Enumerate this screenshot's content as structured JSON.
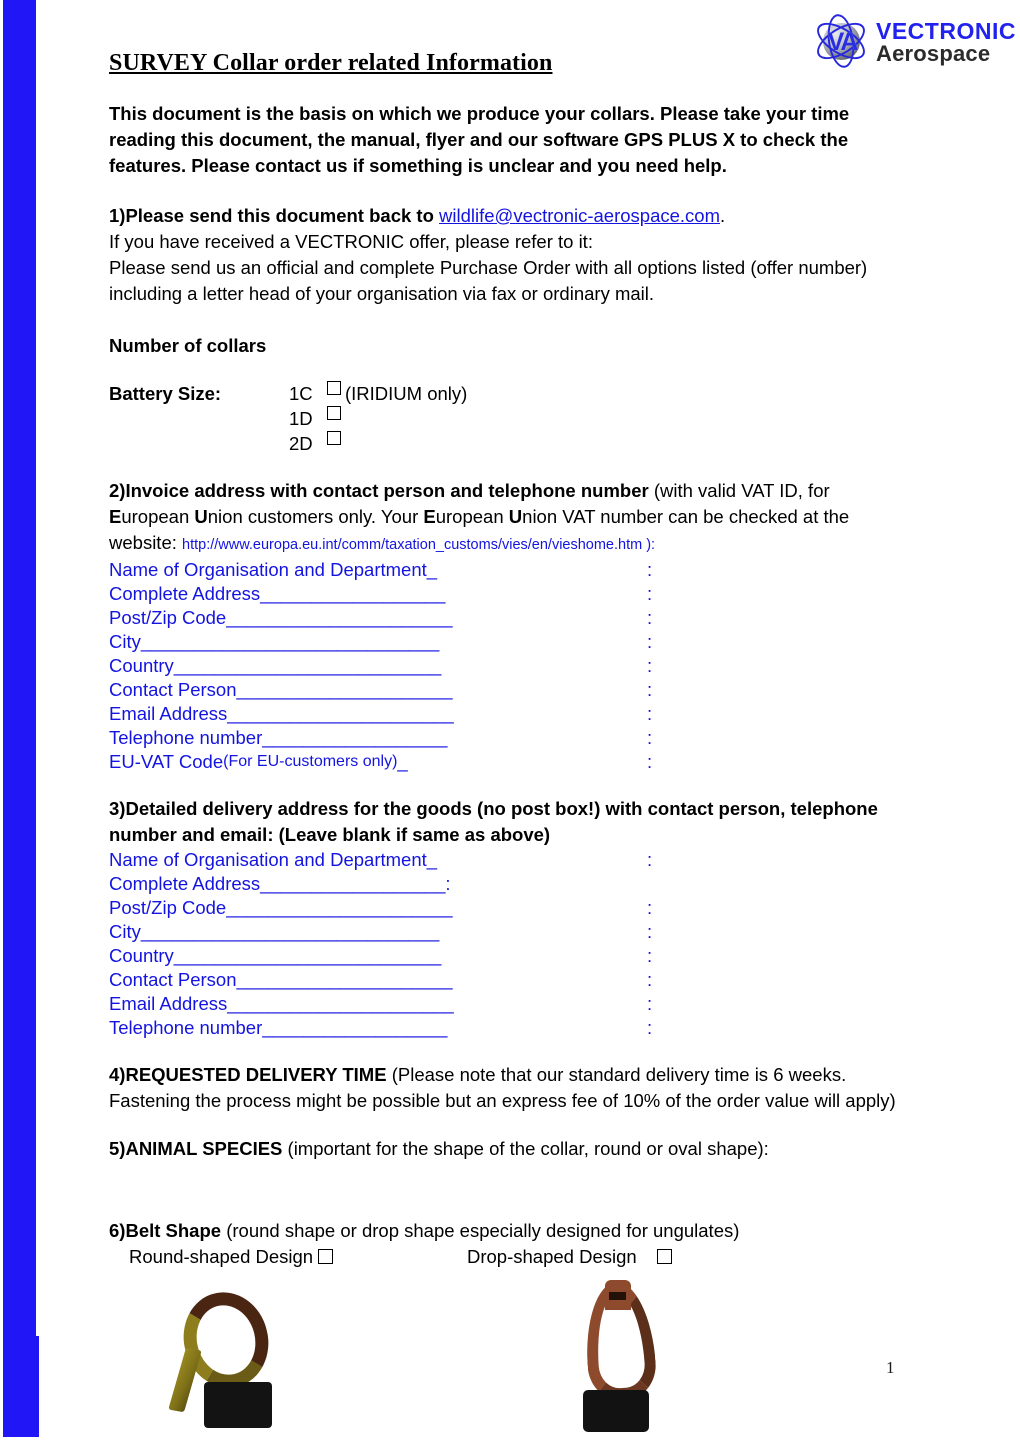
{
  "logo": {
    "monogram": "VA",
    "line1": "VECTRONIC",
    "line2": "Aerospace",
    "brand_blue": "#2222EE",
    "brand_dark": "#2b2b2b"
  },
  "document": {
    "title": "SURVEY Collar order related Information",
    "intro": "This document is the basis on which we produce your collars. Please take your time reading this document, the manual, flyer and our software GPS PLUS X to check the features. Please contact us if something is unclear and you need help.",
    "page_number": "1",
    "link_color": "#1414E0"
  },
  "section1": {
    "number": "1)",
    "lead": "Please send this document back to ",
    "email": "wildlife@vectronic-aerospace.com",
    "after_email": ".",
    "line2": "If you have received a VECTRONIC offer, please refer to it:",
    "line3": "Please send us an official and complete Purchase Order with all options listed (offer number) including a letter head of your organisation via fax or ordinary mail."
  },
  "collars": {
    "heading": "Number of collars",
    "battery_label": "Battery Size:",
    "options": [
      {
        "code": "1C",
        "note": "(IRIDIUM only)"
      },
      {
        "code": "1D",
        "note": ""
      },
      {
        "code": "2D",
        "note": ""
      }
    ]
  },
  "section2": {
    "number": "2)",
    "lead": "Invoice address with contact person and telephone number",
    "body_a": " (with valid VAT ID, for ",
    "eu_e1": "E",
    "eu_rest1": "uropean ",
    "eu_u1": "U",
    "eu_rest2": "nion customers only. Your ",
    "eu_e2": "E",
    "eu_rest3": "uropean ",
    "eu_u2": "U",
    "eu_rest4": "nion VAT number can be checked at the website: ",
    "url": "http://www.europa.eu.int/comm/taxation_customs/vies/en/vieshome.htm ):",
    "fields": [
      {
        "label": "Name of Organisation and Department",
        "rule": "_",
        "colon": ":"
      },
      {
        "label": "Complete Address",
        "rule": "__________________",
        "colon": ":"
      },
      {
        "label": "Post/Zip Code",
        "rule": "______________________",
        "colon": ":"
      },
      {
        "label": "City",
        "rule": "_____________________________",
        "colon": ":"
      },
      {
        "label": "Country",
        "rule": "__________________________",
        "colon": ":"
      },
      {
        "label": "Contact Person",
        "rule": "_____________________",
        "colon": ":"
      },
      {
        "label": "Email Address",
        "rule": "______________________",
        "colon": ":"
      },
      {
        "label": "Telephone number",
        "rule": "__________________",
        "colon": ":"
      },
      {
        "label": "EU-VAT Code ",
        "small": "(For EU-customers only)",
        "rule": "_",
        "colon": ":"
      }
    ]
  },
  "section3": {
    "number": "3)",
    "lead": "Detailed delivery address for the goods (no post box!) with contact person, telephone number and email: (Leave blank if same as above)",
    "fields": [
      {
        "label": "Name of Organisation and Department",
        "rule": "_",
        "colon": ":"
      },
      {
        "label": "Complete Address",
        "rule": "__________________",
        "colon": ":",
        "inline_colon": true
      },
      {
        "label": "Post/Zip Code",
        "rule": "______________________",
        "colon": ":"
      },
      {
        "label": "City",
        "rule": "_____________________________",
        "colon": ":"
      },
      {
        "label": "Country",
        "rule": "__________________________",
        "colon": ":"
      },
      {
        "label": "Contact Person",
        "rule": "_____________________",
        "colon": ":"
      },
      {
        "label": "Email Address",
        "rule": "______________________",
        "colon": ":"
      },
      {
        "label": "Telephone number",
        "rule": "__________________",
        "colon": ":"
      }
    ]
  },
  "section4": {
    "number": "4)",
    "lead": "REQUESTED DELIVERY TIME",
    "body": " (Please note that our standard delivery time is 6 weeks. Fastening the process might be possible but an express fee of 10% of the order value will apply)"
  },
  "section5": {
    "number": "5)",
    "lead": "ANIMAL SPECIES",
    "body": " (important for the shape of the collar, round or oval shape):"
  },
  "section6": {
    "number": "6)",
    "lead": "Belt Shape",
    "body": " (round shape or drop shape especially designed for ungulates)",
    "option_round": "Round-shaped Design",
    "option_drop": "Drop-shaped Design",
    "photo_round_alt": "round-shaped collar photo",
    "photo_drop_alt": "drop-shaped collar photo"
  }
}
